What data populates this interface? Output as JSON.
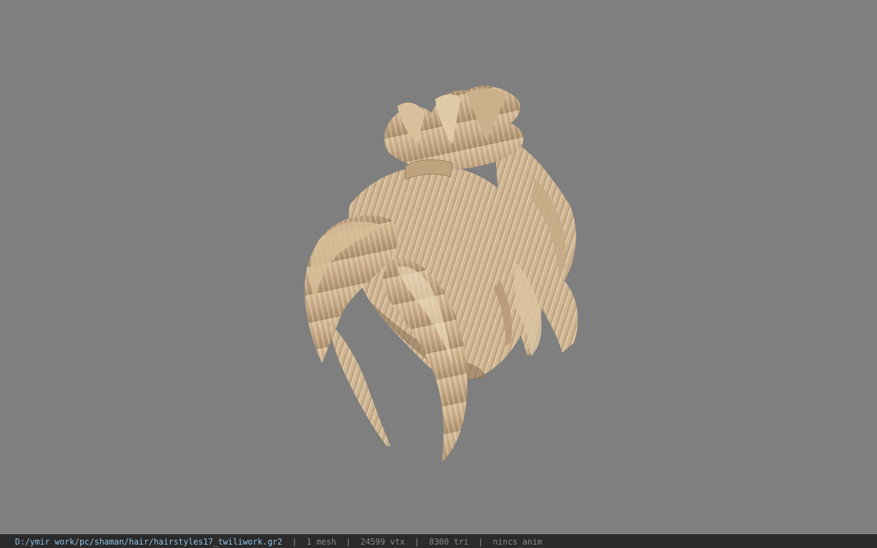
{
  "viewer": {
    "background_color": "#7f7f7f",
    "model_icon": "hair-mesh-icon"
  },
  "statusbar": {
    "path": "D:/ymir work/pc/shaman/hair/hairstyles17_twiliwork.gr2",
    "separator": "|",
    "mesh_count": "1 mesh",
    "vertex_count": "24599 vtx",
    "triangle_count": "8300 tri",
    "anim_status": "nincs anim",
    "path_color": "#8fc3e8",
    "text_color": "#8a8a8a"
  }
}
